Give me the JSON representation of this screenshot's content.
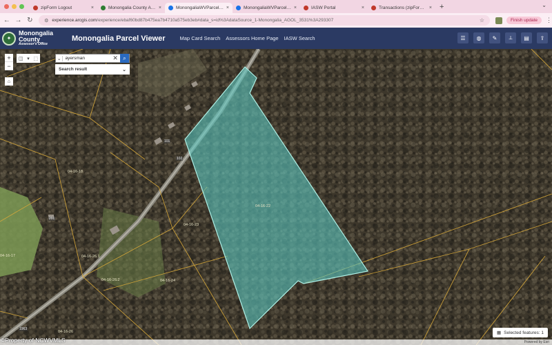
{
  "browser": {
    "tabs": [
      {
        "label": "zipForm Logout",
        "active": false,
        "favicon_color": "#c0392b"
      },
      {
        "label": "Monongalia County Assessor",
        "active": false,
        "favicon_color": "#2e7d32"
      },
      {
        "label": "MonongaliaWVParcelViewer",
        "active": true,
        "favicon_color": "#1a73e8"
      },
      {
        "label": "MonongaliaWVParcelViewer",
        "active": false,
        "favicon_color": "#1a73e8"
      },
      {
        "label": "IASW Portal",
        "active": false,
        "favicon_color": "#c0392b"
      },
      {
        "label": "Transactions (zipForm Edition)",
        "active": false,
        "favicon_color": "#c0392b"
      }
    ],
    "url_host": "experience.arcgis.com",
    "url_path": "/experience/ebaf60bd87b475ea7b4710a575eb3eb#data_s=id%3AdataSource_1-Monongalia_AGOL_3531%3A293307",
    "finish_update": "Finish update"
  },
  "header": {
    "org_line1": "Monongalia",
    "org_line2": "County",
    "org_line3": "Assessor's Office",
    "app_title": "Monongalia Parcel Viewer",
    "nav_links": [
      "Map Card Search",
      "Assessors Home Page",
      "IASW Search"
    ]
  },
  "search": {
    "value": "ayersman",
    "result_label": "Search result"
  },
  "map": {
    "parcel_labels": {
      "selected": "04-16-22",
      "p1": "04-16-18",
      "p2": "04-16-23",
      "p3": "04-16-26.1",
      "p4": "04-16-26.2",
      "p5": "04-16-24",
      "p6": "04-16-26",
      "p7": "04-16-17"
    },
    "address_labels": {
      "a1": "101",
      "a2": "102",
      "a3": "201",
      "a4": "1963"
    },
    "selected_fill": "#5cc6c0",
    "parcel_line_color": "#d8a93a"
  },
  "status": {
    "selected_features": "Selected features: 1",
    "powered_by": "Powered by Esri"
  },
  "watermark": "©Property of NCWVMLS"
}
